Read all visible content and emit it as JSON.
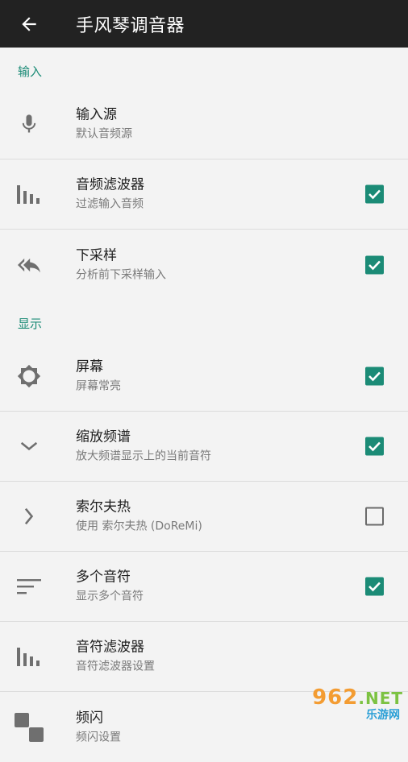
{
  "header": {
    "title": "手风琴调音器"
  },
  "sections": [
    {
      "label": "输入"
    },
    {
      "label": "显示"
    }
  ],
  "rows": [
    {
      "title": "输入源",
      "subtitle": "默认音频源",
      "icon": "microphone-icon"
    },
    {
      "title": "音频滤波器",
      "subtitle": "过滤输入音频",
      "icon": "equalizer-bars-icon",
      "checked": true
    },
    {
      "title": "下采样",
      "subtitle": "分析前下采样输入",
      "icon": "double-reply-arrow-icon",
      "checked": true
    },
    {
      "title": "屏幕",
      "subtitle": "屏幕常亮",
      "icon": "brightness-icon",
      "checked": true
    },
    {
      "title": "缩放频谱",
      "subtitle": "放大频谱显示上的当前音符",
      "icon": "chevron-down-icon",
      "checked": true
    },
    {
      "title": "索尔夫热",
      "subtitle": "使用 索尔夫热 (DoReMi)",
      "icon": "chevron-right-icon",
      "checked": false
    },
    {
      "title": "多个音符",
      "subtitle": "显示多个音符",
      "icon": "sort-lines-icon",
      "checked": true
    },
    {
      "title": "音符滤波器",
      "subtitle": "音符滤波器设置",
      "icon": "equalizer-bars-icon"
    },
    {
      "title": "频闪",
      "subtitle": "频闪设置",
      "icon": "strobe-squares-icon"
    }
  ],
  "watermark": {
    "top": "962",
    "net": ".NET",
    "bottom": "乐游网"
  },
  "colors": {
    "accent": "#1b8b76",
    "appbar": "#222222",
    "background": "#f3f3f3"
  }
}
